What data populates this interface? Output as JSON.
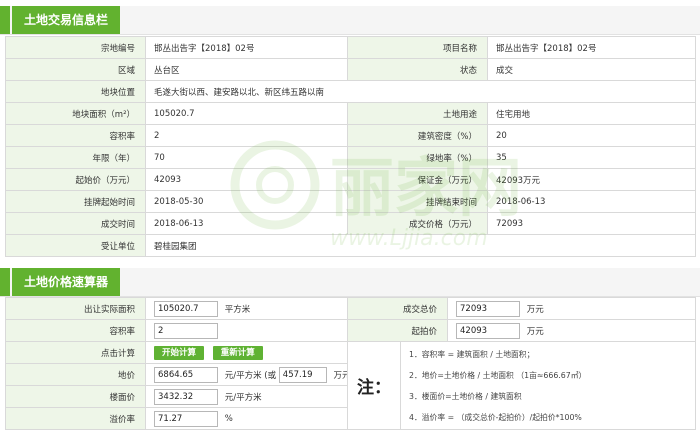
{
  "colors": {
    "accent": "#62b22f",
    "label_bg": "#eef6e8",
    "button": "#5fb233",
    "border": "#d9d9d9"
  },
  "land_info": {
    "title": "土地交易信息栏",
    "rows": [
      [
        {
          "label": "宗地编号",
          "value": "邯丛出告字【2018】02号"
        },
        {
          "label": "项目名称",
          "value": "邯丛出告字【2018】02号"
        }
      ],
      [
        {
          "label": "区域",
          "value": "丛台区"
        },
        {
          "label": "状态",
          "value": "成交"
        }
      ],
      [
        {
          "label": "地块位置",
          "value": "毛遂大街以西、建安路以北、新区纬五路以南",
          "span": true
        }
      ],
      [
        {
          "label": "地块面积（m²）",
          "value": "105020.7"
        },
        {
          "label": "土地用途",
          "value": "住宅用地"
        }
      ],
      [
        {
          "label": "容积率",
          "value": "2"
        },
        {
          "label": "建筑密度（%）",
          "value": "20"
        }
      ],
      [
        {
          "label": "年限（年）",
          "value": "70"
        },
        {
          "label": "绿地率（%）",
          "value": "35"
        }
      ],
      [
        {
          "label": "起始价（万元）",
          "value": "42093"
        },
        {
          "label": "保证金（万元）",
          "value": "42093万元"
        }
      ],
      [
        {
          "label": "挂牌起始时间",
          "value": "2018-05-30"
        },
        {
          "label": "挂牌结束时间",
          "value": "2018-06-13"
        }
      ],
      [
        {
          "label": "成交时间",
          "value": "2018-06-13"
        },
        {
          "label": "成交价格（万元）",
          "value": "72093"
        }
      ],
      [
        {
          "label": "受让单位",
          "value": "碧桂园集团",
          "span": true
        }
      ]
    ]
  },
  "calculator": {
    "title": "土地价格速算器",
    "area_label": "出让实际面积",
    "area_value": "105020.7",
    "area_unit": "平方米",
    "deal_label": "成交总价",
    "deal_value": "72093",
    "deal_unit": "万元",
    "far_label": "容积率",
    "far_value": "2",
    "start_label": "起拍价",
    "start_value": "42093",
    "start_unit": "万元",
    "click_label": "点击计算",
    "start_button": "开始计算",
    "reset_button": "重新计算",
    "land_price_label": "地价",
    "land_price_value": "6864.65",
    "land_price_unit": "元/平方米 (或",
    "land_price_mu_value": "457.19",
    "land_price_mu_unit": "万元/亩)",
    "floor_price_label": "楼面价",
    "floor_price_value": "3432.32",
    "floor_price_unit": "元/平方米",
    "premium_label": "溢价率",
    "premium_value": "71.27",
    "premium_unit": "%",
    "note_head": "注：",
    "notes": [
      "1．容积率 = 建筑面积 / 土地面积；",
      "2．地价=土地价格 / 土地面积 （1亩≈666.67㎡）",
      "3．楼面价=土地价格 / 建筑面积",
      "4．溢价率 = （成交总价-起拍价）/起拍价*100%"
    ]
  },
  "watermark": {
    "brand": "丽家网",
    "url": "www.Ljjia.com"
  }
}
